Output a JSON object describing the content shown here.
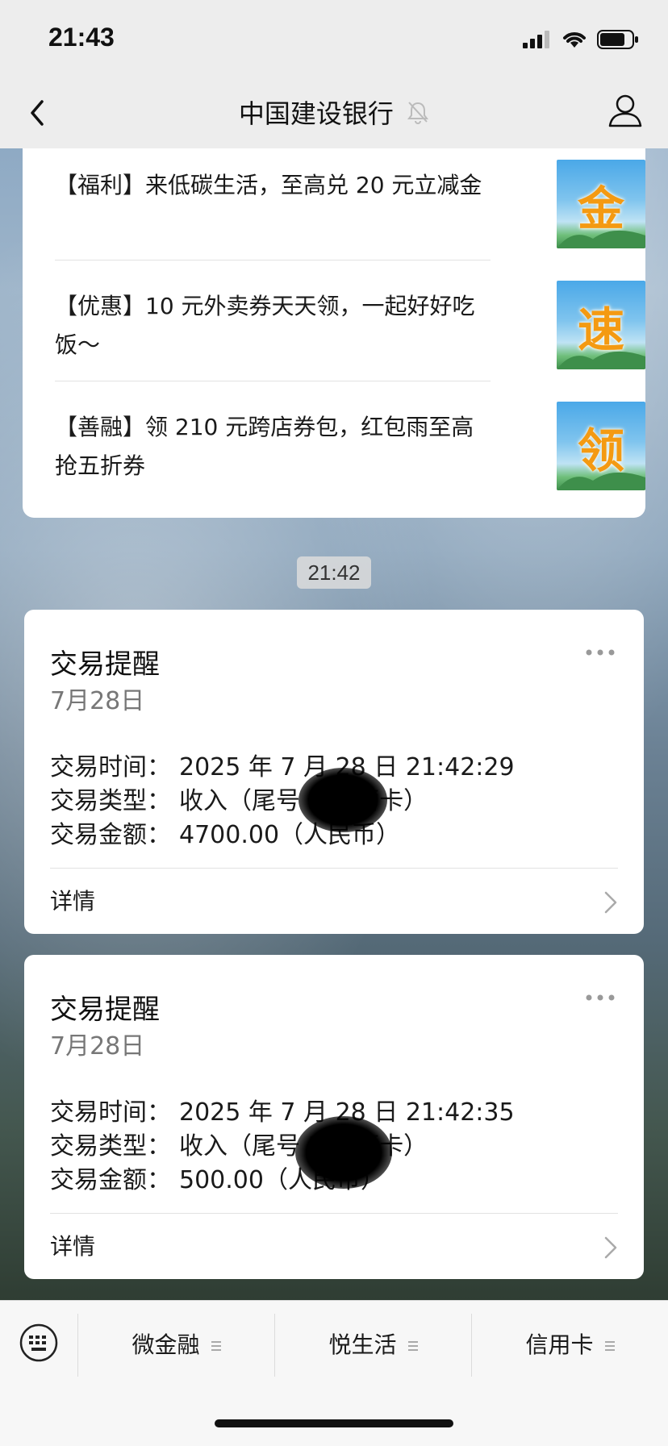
{
  "status_bar": {
    "time": "21:43"
  },
  "header": {
    "title": "中国建设银行"
  },
  "articles": [
    {
      "text": "【福利】来低碳生活，至高兑 20 元立减金",
      "thumb_char": "金"
    },
    {
      "text": "【优惠】10 元外卖券天天领，一起好好吃饭～",
      "thumb_char": "速"
    },
    {
      "text": "【善融】领 210 元跨店券包，红包雨至高抢五折券",
      "thumb_char": "领"
    }
  ],
  "chat_timestamp": "21:42",
  "transactions": [
    {
      "title": "交易提醒",
      "date": "7月28日",
      "time_label": "交易时间：",
      "time_value": "2025 年 7 月 28 日 21:42:29",
      "type_label": "交易类型：",
      "type_value": "收入（尾号 3   储蓄卡）",
      "amount_label": "交易金额：",
      "amount_value": "4700.00（人民币）",
      "detail_label": "详情"
    },
    {
      "title": "交易提醒",
      "date": "7月28日",
      "time_label": "交易时间：",
      "time_value": "2025 年 7 月 28 日 21:42:35",
      "type_label": "交易类型：",
      "type_value": "收入（尾号 3   储蓄卡）",
      "amount_label": "交易金额：",
      "amount_value": "500.00（人民币）",
      "detail_label": "详情"
    }
  ],
  "bottom_menu": [
    {
      "label": "微金融"
    },
    {
      "label": "悦生活"
    },
    {
      "label": "信用卡"
    }
  ],
  "colors": {
    "thumb_char": "#f49a12",
    "header_bg": "#ededed",
    "card_bg": "#ffffff"
  }
}
